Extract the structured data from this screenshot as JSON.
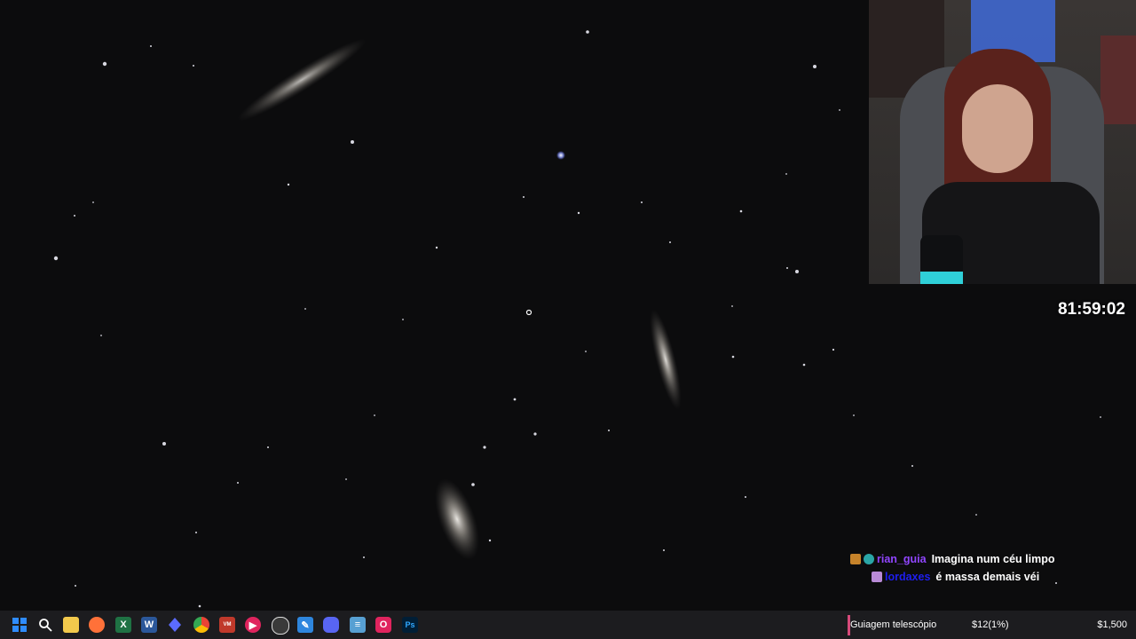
{
  "stream": {
    "timer": "81:59:02"
  },
  "chat": [
    {
      "username": "rian_guia",
      "message": "Imagina num céu limpo",
      "user_color": "#9146ff",
      "badges": [
        "reindeer-badge",
        "globe-badge"
      ]
    },
    {
      "username": "lordaxes",
      "message": "é massa demais véi",
      "user_color": "#1e1ef0",
      "badges": [
        "gift-badge"
      ]
    }
  ],
  "donation_goal": {
    "label": "Guiagem telescópio",
    "raised": "$12(1%)",
    "target": "$1,500",
    "progress_percent": 1,
    "accent_color": "#d64a7a"
  },
  "taskbar": {
    "apps": [
      {
        "icon": "windows-start-icon",
        "color": "#2f8cff"
      },
      {
        "icon": "search-icon",
        "color": "#ffffff"
      },
      {
        "icon": "file-explorer-icon",
        "color": "#f2c94c"
      },
      {
        "icon": "firefox-icon",
        "color": "#ff7139"
      },
      {
        "icon": "excel-icon",
        "color": "#1f7244"
      },
      {
        "icon": "word-icon",
        "color": "#2b579a"
      },
      {
        "icon": "diamond-app-icon",
        "color": "#5b6bff"
      },
      {
        "icon": "chrome-icon",
        "color": "#34a853"
      },
      {
        "icon": "voicemeeter-icon",
        "color": "#c0392b"
      },
      {
        "icon": "media-player-icon",
        "color": "#e0245e"
      },
      {
        "icon": "obs-icon",
        "color": "#3a3a3a"
      },
      {
        "icon": "pen-app-icon",
        "color": "#2e86de"
      },
      {
        "icon": "discord-icon",
        "color": "#5865f2"
      },
      {
        "icon": "notepad-icon",
        "color": "#57a0d3"
      },
      {
        "icon": "opera-icon",
        "color": "#e0245e"
      },
      {
        "icon": "photoshop-icon",
        "color": "#001e36"
      }
    ]
  }
}
